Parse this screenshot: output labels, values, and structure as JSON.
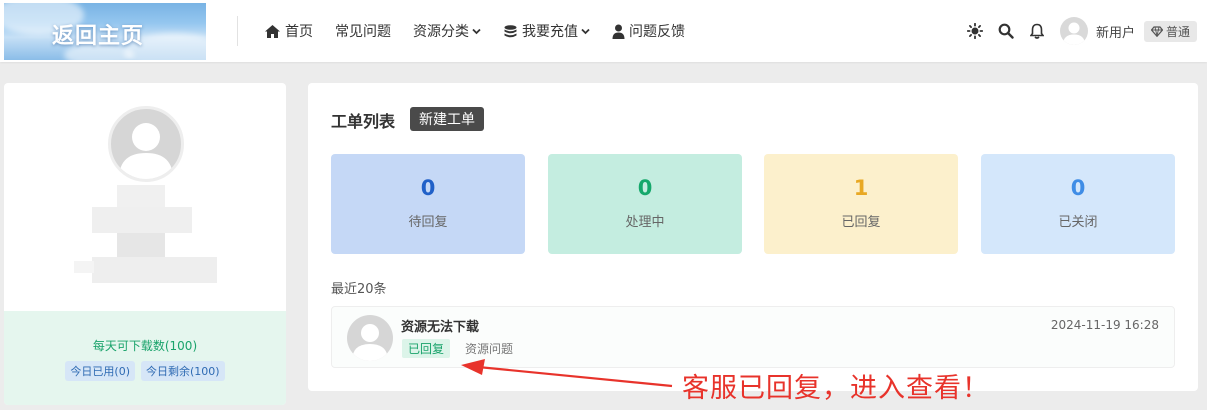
{
  "header": {
    "logo_text": "返回主页",
    "nav": [
      {
        "label": "首页",
        "icon": "home-icon"
      },
      {
        "label": "常见问题"
      },
      {
        "label": "资源分类",
        "dropdown": true
      },
      {
        "label": "我要充值",
        "icon": "coins-icon",
        "dropdown": true
      },
      {
        "label": "问题反馈",
        "icon": "user-icon"
      }
    ],
    "username": "新用户",
    "level": "普通"
  },
  "profile": {
    "download_text": "每天可下载数(100)",
    "used_today": "今日已用(0)",
    "remaining_today": "今日剩余(100)"
  },
  "tickets": {
    "title": "工单列表",
    "new_button": "新建工单",
    "stats": [
      {
        "value": "0",
        "label": "待回复",
        "color": "#2060c8",
        "bg": "#c5d8f6"
      },
      {
        "value": "0",
        "label": "处理中",
        "color": "#15a86b",
        "bg": "#c4ede0"
      },
      {
        "value": "1",
        "label": "已回复",
        "color": "#e8a823",
        "bg": "#fcf0cc"
      },
      {
        "value": "0",
        "label": "已关闭",
        "color": "#3f8de6",
        "bg": "#d4e7fb"
      }
    ],
    "recent_label": "最近20条",
    "rows": [
      {
        "title": "资源无法下载",
        "status": "已回复",
        "category": "资源问题",
        "time": "2024-11-19 16:28"
      }
    ]
  },
  "annotation": {
    "text": "客服已回复，进入查看！",
    "color": "#e8332b"
  }
}
